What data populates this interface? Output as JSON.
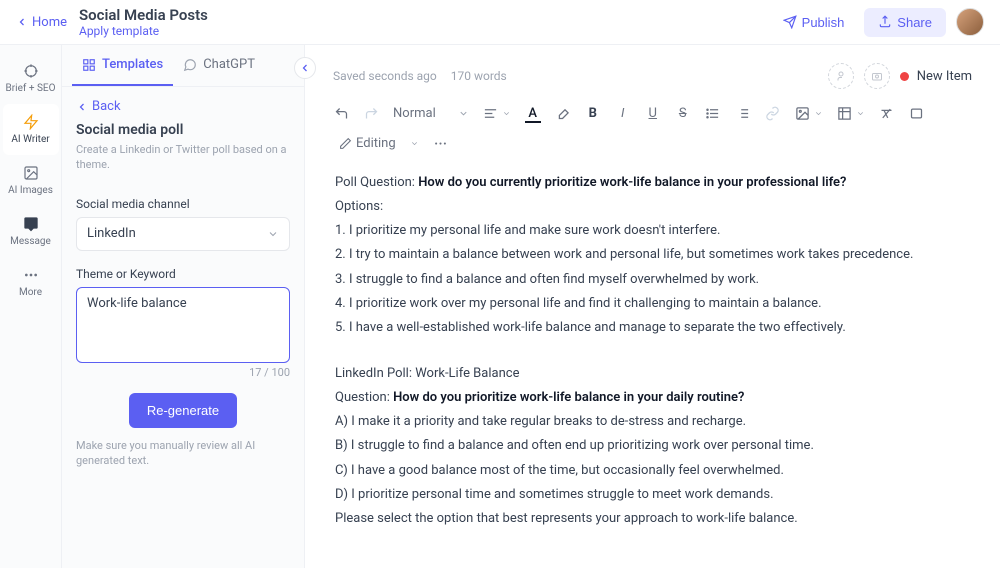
{
  "header": {
    "home": "Home",
    "title": "Social Media Posts",
    "apply_template": "Apply template",
    "publish": "Publish",
    "share": "Share"
  },
  "rail": {
    "items": [
      {
        "label": "Brief + SEO"
      },
      {
        "label": "AI Writer"
      },
      {
        "label": "AI Images"
      },
      {
        "label": "Message"
      },
      {
        "label": "More"
      }
    ]
  },
  "panel": {
    "tabs": {
      "templates": "Templates",
      "chatgpt": "ChatGPT"
    },
    "back": "Back",
    "title": "Social media poll",
    "desc": "Create a Linkedin or Twitter poll based on a theme.",
    "channel_label": "Social media channel",
    "channel_value": "LinkedIn",
    "theme_label": "Theme or Keyword",
    "theme_value": "Work-life balance",
    "char_count": "17 / 100",
    "regenerate": "Re-generate",
    "helper": "Make sure you manually review all AI generated text."
  },
  "editor": {
    "saved": "Saved seconds ago",
    "words": "170 words",
    "new_item": "New Item",
    "style": "Normal",
    "mode": "Editing"
  },
  "doc": {
    "s1": {
      "q_prefix": "Poll Question: ",
      "q_bold": "How do you currently prioritize work-life balance in your professional life?",
      "options_label": "Options:",
      "opts": [
        "1. I prioritize my personal life and make sure work doesn't interfere.",
        "2. I try to maintain a balance between work and personal life, but sometimes work takes precedence.",
        "3. I struggle to find a balance and often find myself overwhelmed by work.",
        "4. I prioritize work over my personal life and find it challenging to maintain a balance.",
        "5. I have a well-established work-life balance and manage to separate the two effectively."
      ]
    },
    "s2": {
      "heading": "LinkedIn Poll: Work-Life Balance",
      "q_prefix": "Question: ",
      "q_bold": "How do you prioritize work-life balance in your daily routine?",
      "opts": [
        "A) I make it a priority and take regular breaks to de-stress and recharge.",
        "B) I struggle to find a balance and often end up prioritizing work over personal time.",
        "C) I have a good balance most of the time, but occasionally feel overwhelmed.",
        "D) I prioritize personal time and sometimes struggle to meet work demands."
      ],
      "cta": "Please select the option that best represents your approach to work-life balance."
    }
  }
}
